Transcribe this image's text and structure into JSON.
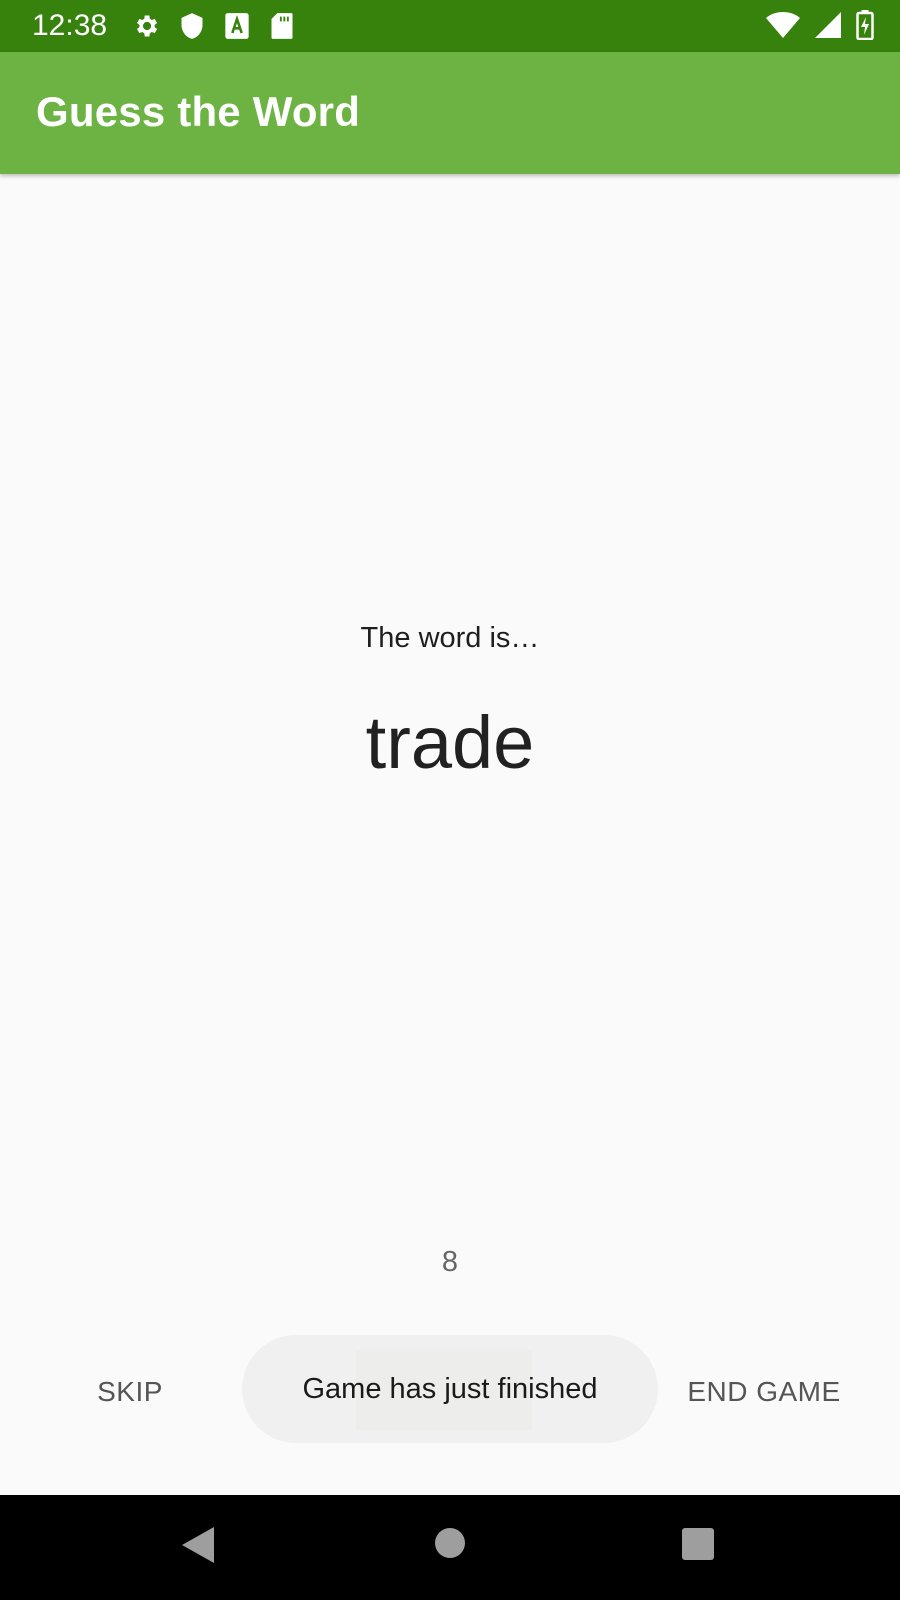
{
  "status_bar": {
    "time": "12:38",
    "left_icons": [
      "gear-icon",
      "shield-icon",
      "font-a-icon",
      "sd-card-icon"
    ],
    "right_icons": [
      "wifi-icon",
      "cell-signal-icon",
      "battery-charging-icon"
    ]
  },
  "app_bar": {
    "title": "Guess the Word"
  },
  "game": {
    "intro": "The word is…",
    "word": "trade",
    "score": "8"
  },
  "buttons": {
    "skip": "SKIP",
    "end_game": "END GAME"
  },
  "toast": {
    "message": "Game has just finished"
  },
  "nav_bar": {
    "icons": [
      "back-icon",
      "home-icon",
      "recents-icon"
    ]
  },
  "colors": {
    "status_bar": "#37810d",
    "app_bar": "#6cb343",
    "background": "#fafafa"
  }
}
